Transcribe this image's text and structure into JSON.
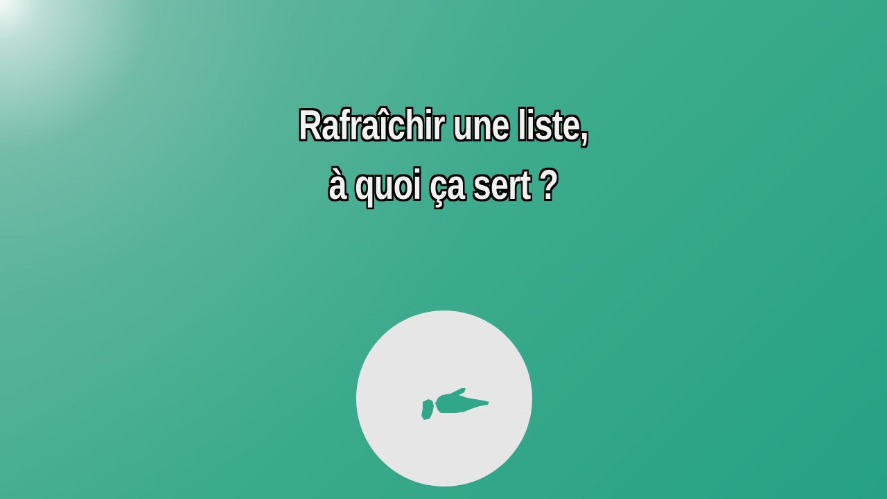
{
  "title": {
    "line1": "Rafraîchir une liste,",
    "line2": "à quoi ça sert ?"
  },
  "button": {
    "icon": "pointing-hand-icon"
  },
  "colors": {
    "background": "#2fa788",
    "button": "#e6e6e6",
    "icon": "#2fa788",
    "title_fill": "#f2f2f2",
    "title_outline": "#000000"
  }
}
